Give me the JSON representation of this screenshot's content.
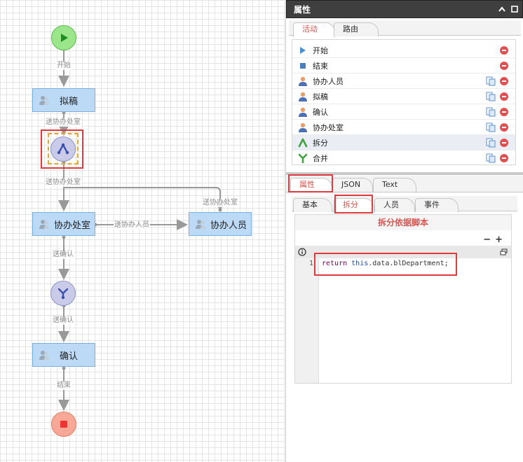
{
  "canvas": {
    "nodes": {
      "start": "开始",
      "draft": "拟稿",
      "co_office": "协办处室",
      "co_person": "协办人员",
      "confirm": "确认"
    },
    "edges": {
      "e_start": "开始",
      "e_send_co_office_1": "送协办处室",
      "e_send_co_office_2": "送协办处室",
      "e_send_co_office_3": "送协办处室",
      "e_send_co_person": "送协办人员",
      "e_send_confirm_1": "送确认",
      "e_send_confirm_2": "送确认",
      "e_end": "结束"
    }
  },
  "panel": {
    "title": "属性",
    "top_tabs": [
      "活动",
      "路由"
    ],
    "activities": [
      {
        "label": "开始",
        "icon": "play-icon"
      },
      {
        "label": "结束",
        "icon": "stop-icon"
      },
      {
        "label": "协办人员",
        "icon": "person-icon"
      },
      {
        "label": "拟稿",
        "icon": "person-icon"
      },
      {
        "label": "确认",
        "icon": "person-icon"
      },
      {
        "label": "协办处室",
        "icon": "person-icon"
      },
      {
        "label": "拆分",
        "icon": "split-icon"
      },
      {
        "label": "合并",
        "icon": "merge-icon"
      }
    ],
    "mid_tabs": [
      "属性",
      "JSON",
      "Text"
    ],
    "sub_tabs": [
      "基本",
      "拆分",
      "人员",
      "事件"
    ],
    "editor": {
      "title": "拆分依据脚本",
      "minus": "−",
      "plus": "+",
      "line_no": "1",
      "code_kw": "return",
      "code_this": "this",
      "code_rest": ".data.blDepartment;"
    }
  },
  "colors": {
    "accent_red": "#d9534f",
    "highlight_red": "#e0393e",
    "node_fill": "#bcd9f5",
    "start_fill": "#9be58a",
    "end_fill": "#f7a896",
    "gate_fill": "#c9cbe8"
  }
}
